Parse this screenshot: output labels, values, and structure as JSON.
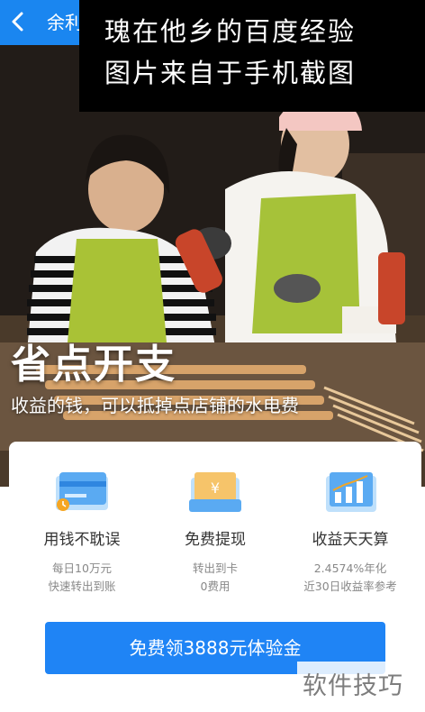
{
  "header": {
    "title": "余利宝"
  },
  "watermark": {
    "line1": "瑰在他乡的百度经验",
    "line2": "图片来自于手机截图"
  },
  "hero": {
    "title": "省点开支",
    "subtitle": "收益的钱，可以抵掉点店铺的水电费"
  },
  "features": [
    {
      "icon": "card-clock-icon",
      "name": "用钱不耽误",
      "desc1": "每日10万元",
      "desc2": "快速转出到账"
    },
    {
      "icon": "yuan-card-icon",
      "name": "免费提现",
      "desc1": "转出到卡",
      "desc2": "0费用"
    },
    {
      "icon": "bar-chart-icon",
      "name": "收益天天算",
      "desc1": "2.4574%年化",
      "desc2": "近30日收益率参考"
    }
  ],
  "cta": {
    "label": "免费领3888元体验金"
  },
  "brand_mark": "软件技巧",
  "colors": {
    "accent": "#1f84f5",
    "topbar": "#1a86f0"
  }
}
